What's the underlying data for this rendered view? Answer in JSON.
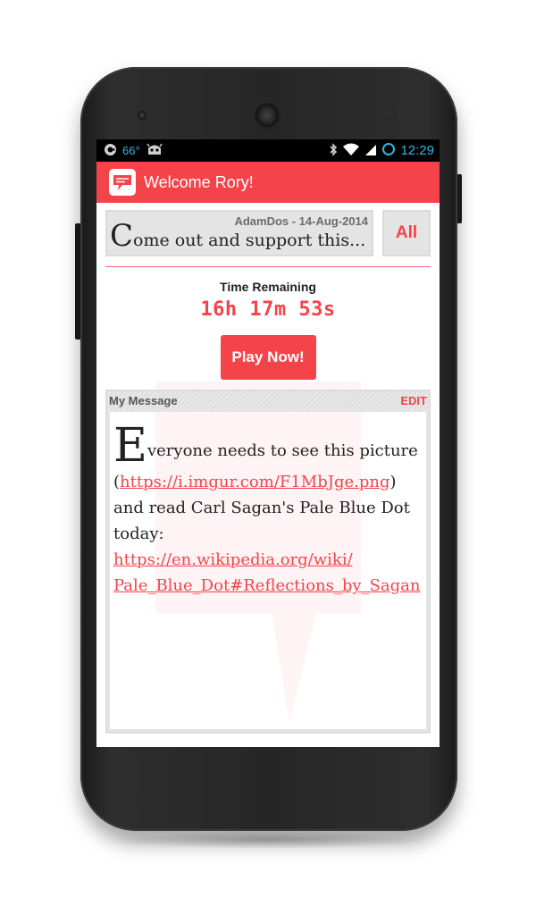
{
  "status_bar": {
    "temperature": "66°",
    "time": "12:29",
    "icons": [
      "notification-icon",
      "android-icon",
      "bluetooth-icon",
      "wifi-icon",
      "signal-icon",
      "battery-icon"
    ]
  },
  "action_bar": {
    "title": "Welcome Rory!",
    "logo_icon": "chat-bubble-icon"
  },
  "message_card": {
    "meta": "AdamDos - 14-Aug-2014",
    "preview_first_letter": "C",
    "preview_rest": "ome out and support this..."
  },
  "all_button": {
    "label": "All"
  },
  "timer": {
    "label": "Time Remaining",
    "value": "16h 17m 53s"
  },
  "play_button": {
    "label": "Play Now!"
  },
  "my_message": {
    "title": "My Message",
    "edit_label": "EDIT",
    "body_first_letter": "E",
    "body_part1": "veryone needs to see this picture (",
    "link1": "https://i.imgur.com/F1MbJge.png",
    "body_part2": ") and read Carl Sagan's Pale Blue Dot today: ",
    "link2_line1": "https://en.wikipedia.org/wiki/",
    "link2_line2": "Pale_Blue_Dot#Reflections_by_Sagan"
  },
  "colors": {
    "accent": "#f5434a",
    "statusbar_blue": "#33b5e5"
  }
}
